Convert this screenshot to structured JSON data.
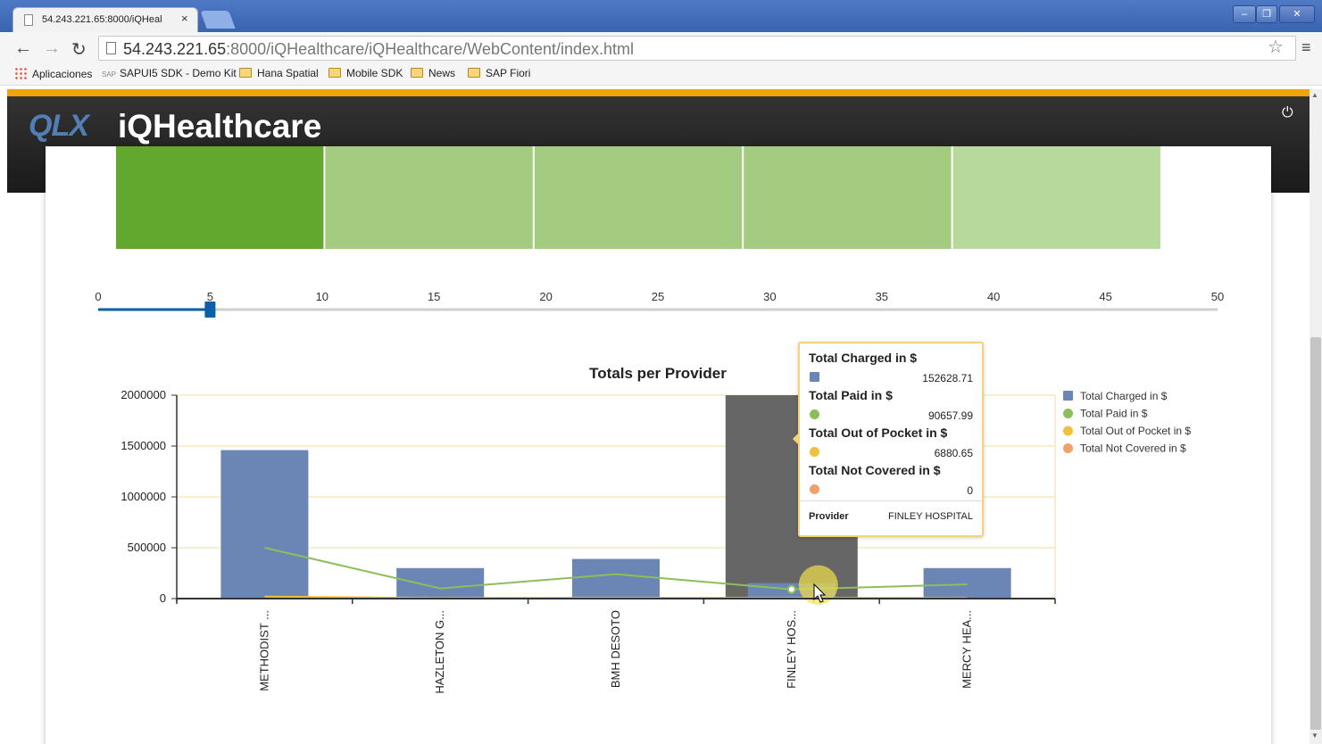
{
  "browser": {
    "tab_title": "54.243.221.65:8000/iQHeal",
    "tab_close": "×",
    "url_host": "54.243.221.65",
    "url_rest": ":8000/iQHealthcare/iQHealthcare/WebContent/index.html",
    "bookmarks": [
      {
        "label": "Aplicaciones",
        "icon": "apps-icon"
      },
      {
        "label": "SAPUI5 SDK - Demo Kit",
        "icon": "sap-icon"
      },
      {
        "label": "Hana Spatial",
        "icon": "folder-icon"
      },
      {
        "label": "Mobile SDK",
        "icon": "folder-icon"
      },
      {
        "label": "News",
        "icon": "folder-icon"
      },
      {
        "label": "SAP Fiori",
        "icon": "folder-icon"
      }
    ]
  },
  "app": {
    "logo": "QLX",
    "title": "iQHealthcare",
    "power_icon": "power-icon"
  },
  "heatmap": {
    "colors": [
      "#62a72e",
      "#a3cc80",
      "#a3cc80",
      "#a3cc80",
      "#b8d99c"
    ]
  },
  "slider": {
    "min": 0,
    "max": 50,
    "value": 5,
    "ticks": [
      "0",
      "5",
      "10",
      "15",
      "20",
      "25",
      "30",
      "35",
      "40",
      "45",
      "50"
    ],
    "accent": "#0a5fa6"
  },
  "chart_data": {
    "type": "bar",
    "title": "Totals per Provider",
    "categories": [
      "METHODIST ...",
      "HAZLETON G...",
      "BMH DESOTO",
      "FINLEY HOS...",
      "MERCY HEA..."
    ],
    "ylim": [
      0,
      2000000
    ],
    "yticks": [
      "0",
      "500000",
      "1000000",
      "1500000",
      "2000000"
    ],
    "series": [
      {
        "name": "Total Charged in $",
        "type": "bar",
        "color": "#6b86b4",
        "values": [
          1460000,
          300000,
          390000,
          152628.71,
          300000
        ]
      },
      {
        "name": "Total Paid in $",
        "type": "line",
        "color": "#8cbf5a",
        "values": [
          500000,
          100000,
          240000,
          90657.99,
          140000
        ]
      },
      {
        "name": "Total Out of Pocket in $",
        "type": "line",
        "color": "#f0c040",
        "values": [
          20000,
          6000,
          8000,
          6880.65,
          6000
        ]
      },
      {
        "name": "Total Not Covered in $",
        "type": "line",
        "color": "#f2a06a",
        "values": [
          0,
          0,
          0,
          0,
          0
        ]
      }
    ],
    "highlight_index": 3,
    "highlight_color": "#666666",
    "legend_position": "right"
  },
  "tooltip": {
    "items": [
      {
        "label": "Total Charged in $",
        "value": "152628.71",
        "color": "#6b86b4",
        "shape": "square"
      },
      {
        "label": "Total Paid in $",
        "value": "90657.99",
        "color": "#8cbf5a",
        "shape": "circle"
      },
      {
        "label": "Total Out of Pocket in $",
        "value": "6880.65",
        "color": "#f0c040",
        "shape": "circle"
      },
      {
        "label": "Total Not Covered in $",
        "value": "0",
        "color": "#f2a06a",
        "shape": "circle"
      }
    ],
    "provider_label": "Provider",
    "provider_value": "FINLEY HOSPITAL"
  }
}
